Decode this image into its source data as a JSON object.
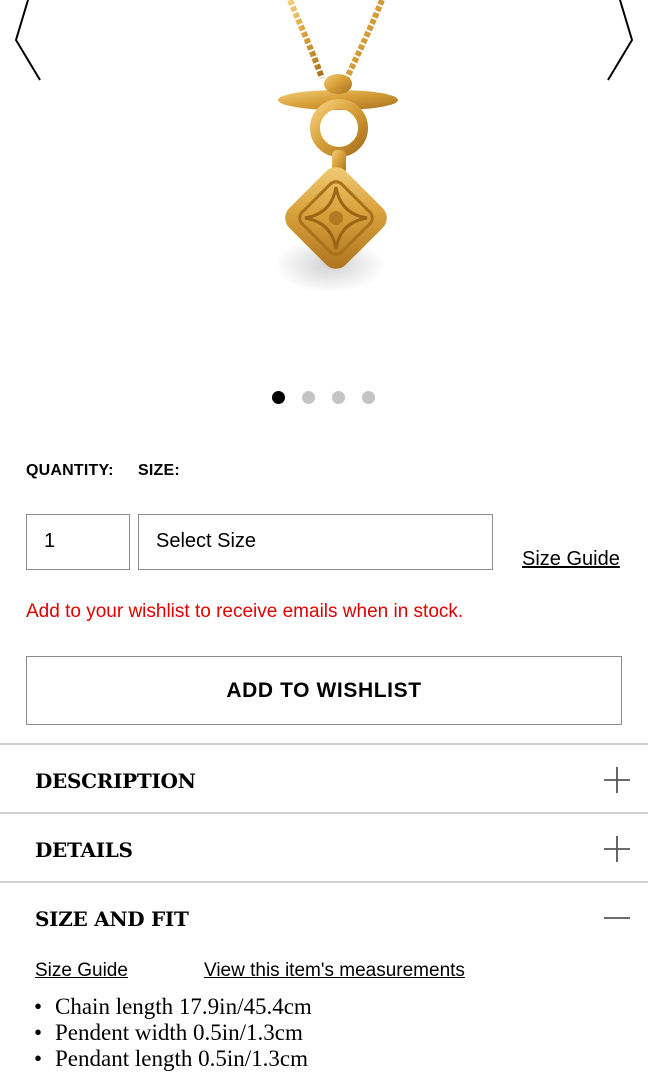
{
  "gallery": {
    "image_alt": "Gold toggle necklace with anagram pendant",
    "dot_count": 4,
    "active_index": 0
  },
  "form": {
    "quantity_label": "QUANTITY:",
    "size_label": "SIZE:",
    "quantity_value": "1",
    "size_placeholder": "Select Size",
    "size_guide_link": "Size Guide"
  },
  "stock_message": "Add to your wishlist to receive emails when in stock.",
  "wishlist_button": "ADD TO WISHLIST",
  "accordion": [
    {
      "title": "DESCRIPTION",
      "expanded": false
    },
    {
      "title": "DETAILS",
      "expanded": false
    },
    {
      "title": "SIZE AND FIT",
      "expanded": true
    }
  ],
  "size_fit": {
    "size_guide_link": "Size Guide",
    "measurements_link": "View this item's measurements",
    "bullets": [
      "Chain length 17.9in/45.4cm",
      "Pendent width 0.5in/1.3cm",
      "Pendant length 0.5in/1.3cm"
    ]
  },
  "colors": {
    "error_red": "#e00000",
    "gold": "#d9a13b"
  }
}
